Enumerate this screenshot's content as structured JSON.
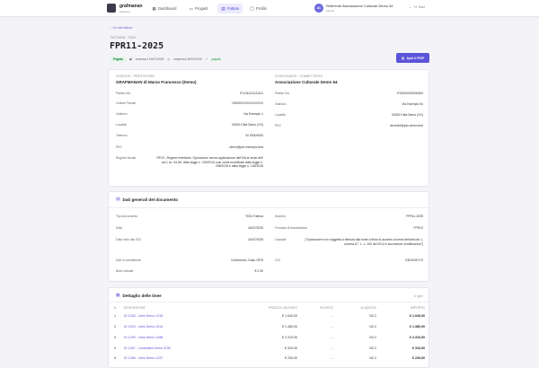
{
  "app": {
    "brand": "grafmanan",
    "brand_sub": "Gestione"
  },
  "nav": [
    {
      "label": "Dashboard",
      "icon": "dashboard-icon",
      "glyph": "▦"
    },
    {
      "label": "Progetti",
      "icon": "folder-icon",
      "glyph": "▭"
    },
    {
      "label": "Fatture",
      "icon": "invoice-icon",
      "glyph": "▤"
    },
    {
      "label": "Profilo",
      "icon": "user-icon",
      "glyph": "◯"
    }
  ],
  "user": {
    "initials": "AC",
    "name": "Referente Associazione Culturale Demo 54",
    "role": "Cliente",
    "logout": "Esci"
  },
  "header": {
    "back": "← Le mie fatture",
    "kicker": "FATTURA · TD01",
    "title": "FPR11-2025",
    "badge": "Pagata",
    "emitted": "emessa il 16/07/2025",
    "due": "scadenza 30/07/2025",
    "status": "pagata",
    "pdf_button": "Apri il PDF"
  },
  "seller": {
    "heading": "CEDENTE / PRESTATORE",
    "name": "GRAFMANAN di Marzo Francesco (Demo)",
    "rows": [
      {
        "label": "Partita IVA",
        "value": "IT11111111111111"
      },
      {
        "label": "Codice Fiscale",
        "value": "DEMXXXXXXXXXXXX"
      },
      {
        "label": "Indirizzo",
        "value": "Via Esempio 1"
      },
      {
        "label": "Località",
        "value": "00000 Città Demo (XX)"
      },
      {
        "label": "Telefono",
        "value": "00 00000000"
      },
      {
        "label": "PEC",
        "value": "demo@pec.esempio.test"
      },
      {
        "label": "Regime fiscale",
        "value": "RF19 - Regime forfettario. Operazione senza applicazione dell'IVA ai sensi dell' art.1 co. 54-89, della legge n. 190/2014 così come modificata dalla legge n. 208/2015 e dalla legge n. 145/2018"
      }
    ]
  },
  "buyer": {
    "heading": "CESSIONARIO / COMMITTENTE",
    "name": "Associazione Culturale Demo 54",
    "rows": [
      {
        "label": "Partita IVA",
        "value": "IT00000000000054"
      },
      {
        "label": "Indirizzo",
        "value": "Via Esempio 54"
      },
      {
        "label": "Località",
        "value": "00000 Città Demo (XX)"
      },
      {
        "label": "PEC",
        "value": "demo54@pec.demo.test"
      }
    ]
  },
  "general": {
    "title": "Dati generali del documento",
    "left": [
      {
        "label": "Tipo documento",
        "value": "TD01 Fattura"
      },
      {
        "label": "Data",
        "value": "16/07/2025"
      },
      {
        "label": "Data invio allo SDI",
        "value": "16/07/2025"
      },
      {
        "label": "Dati il committente",
        "value": "Conferenze, Data: 0575"
      },
      {
        "label": "Bollo virtuale",
        "value": "€ 2,00"
      }
    ],
    "right": [
      {
        "label": "Numero",
        "value": "FPR11-2025"
      },
      {
        "label": "Formato di trasmissione",
        "value": "FPR12"
      },
      {
        "label": "Causale",
        "value": "[\"Operazione non soggetta a ritenuta alla fonte a titolo di acconto ai sensi dell'articolo 1, comma 67, L. n. 190 del 2014 e successive modificazioni\"]"
      },
      {
        "label": "CIG",
        "value": "Z3D100E170"
      }
    ]
  },
  "lines": {
    "title": "Dettaglio delle linee",
    "count": "6 righe",
    "headers": {
      "n": "N.",
      "desc": "DESCRIZIONE",
      "unit": "PREZZO UNITARIO",
      "disc": "SCONTO",
      "vat": "ALIQUOTA",
      "total": "IMPORTO"
    },
    "rows": [
      {
        "n": "1",
        "desc": "ID 1245 - Libro Demo 1218",
        "unit": "€ 1.040,00",
        "disc": "—",
        "vat": "N2.2",
        "total": "€ 1.040,00"
      },
      {
        "n": "2",
        "desc": "ID 1015 - Libro Demo 1014",
        "unit": "€ 1.380,00",
        "disc": "—",
        "vat": "N2.2",
        "total": "€ 1.380,00"
      },
      {
        "n": "3",
        "desc": "ID 1299 - Libro Demo 1288",
        "unit": "€ 2.310,00",
        "disc": "—",
        "vat": "N2.2",
        "total": "€ 2.310,00"
      },
      {
        "n": "4",
        "desc": "ID 1267 - Locandina Demo 1136",
        "unit": "€ 310,00",
        "disc": "—",
        "vat": "N2.2",
        "total": "€ 310,00"
      },
      {
        "n": "5",
        "desc": "ID 1268 - Libro Demo 1137",
        "unit": "€ 230,00",
        "disc": "—",
        "vat": "N2.2",
        "total": "€ 230,00"
      }
    ]
  },
  "colors": {
    "accent": "#5b54d9",
    "paid": "#1e7b3e"
  }
}
